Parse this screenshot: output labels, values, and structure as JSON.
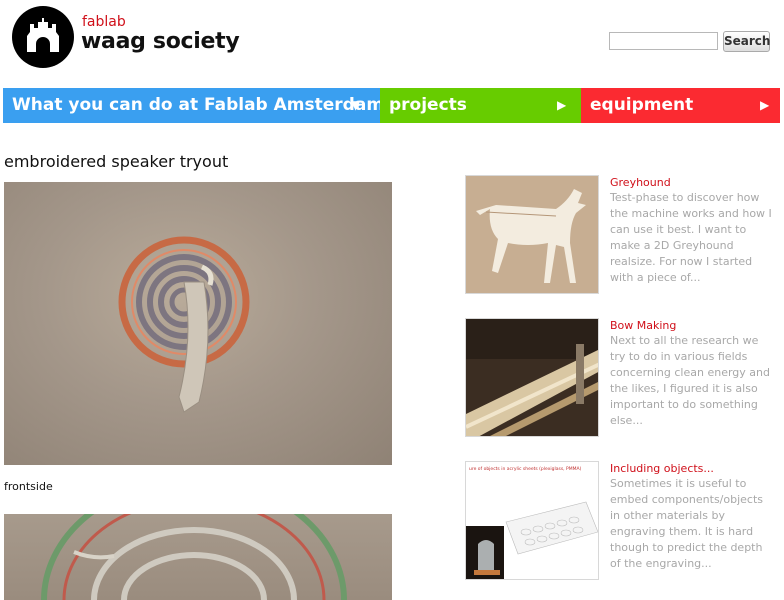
{
  "header": {
    "brand_small": "fablab",
    "brand_big": "waag society",
    "search_placeholder": "",
    "search_button": "Search"
  },
  "nav": [
    {
      "label": "What you can do at Fablab Amsterdam",
      "arrow": "▼",
      "color": "#3a9ff0"
    },
    {
      "label": "projects",
      "arrow": "▶",
      "color": "#67cc00"
    },
    {
      "label": "equipment",
      "arrow": "▶",
      "color": "#fb2a31"
    }
  ],
  "post": {
    "title": "embroidered speaker tryout",
    "caption": "frontside"
  },
  "sidebar": [
    {
      "title": "Greyhound",
      "text": "Test-phase to discover how the machine works and how I can use it best. I want to make a 2D Greyhound realsize. For now I started with a piece of..."
    },
    {
      "title": "Bow Making",
      "text": "Next to all the research we try to do in various fields concerning clean energy and the likes, I figured it is also important to do something else..."
    },
    {
      "title": "Including objects...",
      "text": "Sometimes it is useful to embed components/objects in other materials by engraving them. It is hard though to predict the depth of the engraving..."
    }
  ],
  "thumb3_caption": "ure of objects in acrylic sheets (plexiglass, PMMA)"
}
